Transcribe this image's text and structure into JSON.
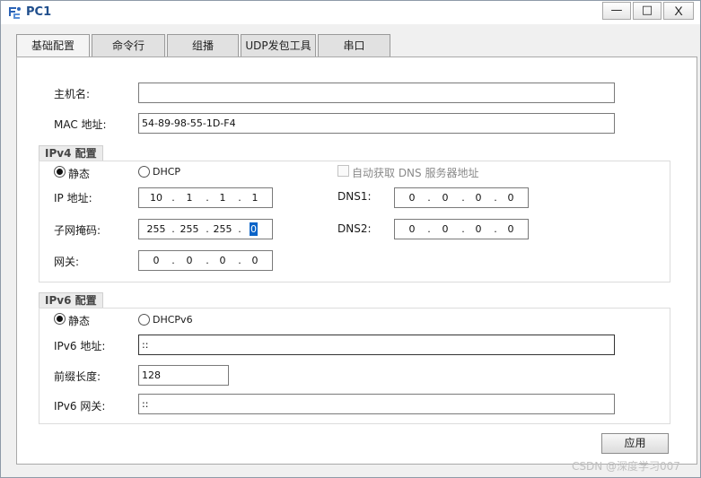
{
  "window": {
    "title": "PC1",
    "minimize_glyph": "—",
    "maximize_glyph": "□",
    "close_glyph": "X"
  },
  "tabs": [
    {
      "label": "基础配置",
      "active": true
    },
    {
      "label": "命令行",
      "active": false
    },
    {
      "label": "组播",
      "active": false
    },
    {
      "label": "UDP发包工具",
      "active": false
    },
    {
      "label": "串口",
      "active": false
    }
  ],
  "basic": {
    "hostname_label": "主机名:",
    "hostname_value": "",
    "mac_label": "MAC 地址:",
    "mac_value": "54-89-98-55-1D-F4"
  },
  "ipv4": {
    "section_title": "IPv4 配置",
    "static_label": "静态",
    "dhcp_label": "DHCP",
    "mode": "static",
    "auto_dns_label": "自动获取 DNS 服务器地址",
    "auto_dns_checked": false,
    "ip_label": "IP 地址:",
    "ip": [
      "10",
      "1",
      "1",
      "1"
    ],
    "mask_label": "子网掩码:",
    "mask": [
      "255",
      "255",
      "255",
      "0"
    ],
    "gateway_label": "网关:",
    "gateway": [
      "0",
      "0",
      "0",
      "0"
    ],
    "dns1_label": "DNS1:",
    "dns1": [
      "0",
      "0",
      "0",
      "0"
    ],
    "dns2_label": "DNS2:",
    "dns2": [
      "0",
      "0",
      "0",
      "0"
    ]
  },
  "ipv6": {
    "section_title": "IPv6 配置",
    "static_label": "静态",
    "dhcp_label": "DHCPv6",
    "mode": "static",
    "address_label": "IPv6 地址:",
    "address_value": "::",
    "prefix_label": "前缀长度:",
    "prefix_value": "128",
    "gateway_label": "IPv6 网关:",
    "gateway_value": "::"
  },
  "apply_button": "应用",
  "watermark": "CSDN @深度学习007",
  "colors": {
    "title_text": "#1f4e8c",
    "selection": "#0a64c8",
    "app_icon": "#2b63b6"
  },
  "icons": {
    "app": "network-pc-icon"
  }
}
